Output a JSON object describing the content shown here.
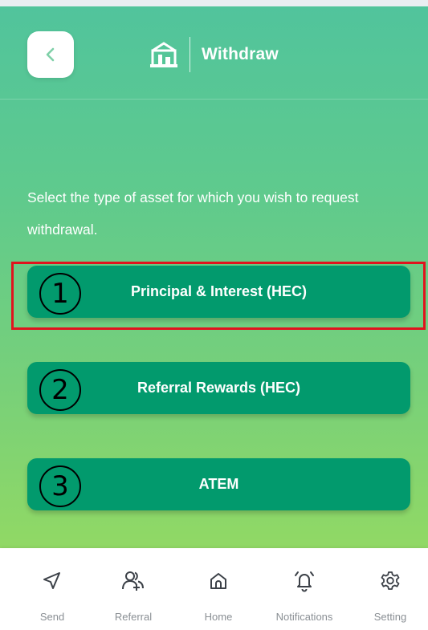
{
  "header": {
    "back_icon": "chevron-left-icon",
    "logo_icon": "building-logo-icon",
    "title": "Withdraw"
  },
  "instruction": "Select the type of asset for which you wish to request withdrawal.",
  "options": [
    {
      "label": "Principal & Interest (HEC)",
      "marker": "①"
    },
    {
      "label": "Referral Rewards (HEC)",
      "marker": "②"
    },
    {
      "label": "ATEM",
      "marker": "③"
    }
  ],
  "nav": [
    {
      "label": "Send",
      "icon": "send-icon"
    },
    {
      "label": "Referral",
      "icon": "referral-icon"
    },
    {
      "label": "Home",
      "icon": "home-icon"
    },
    {
      "label": "Notifications",
      "icon": "bell-icon"
    },
    {
      "label": "Setting",
      "icon": "gear-icon"
    }
  ],
  "colors": {
    "accent": "#029a6d",
    "gradient_top": "#51c49c",
    "gradient_bottom": "#9ddc5e",
    "highlight": "#e0141e",
    "nav_icon": "#3c4148",
    "nav_label": "#8a8f94"
  }
}
